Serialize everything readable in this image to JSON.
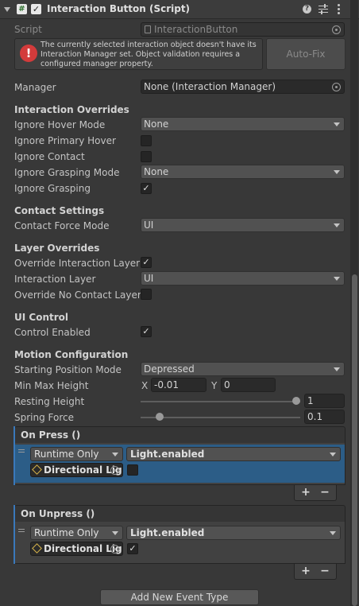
{
  "header": {
    "title": "Interaction Button (Script)",
    "script_icon_glyph": "#"
  },
  "script_row": {
    "label": "Script",
    "value": "InteractionButton"
  },
  "warning": {
    "message": "The currently selected interaction object doesn't have its Interaction Manager set.  Object validation requires a configured manager property.",
    "button": "Auto-Fix",
    "icon_color": "#d33b3b"
  },
  "manager": {
    "label": "Manager",
    "value": "None (Interaction Manager)"
  },
  "interaction_overrides": {
    "title": "Interaction Overrides",
    "ignore_hover_mode": {
      "label": "Ignore Hover Mode",
      "value": "None"
    },
    "ignore_primary_hover": {
      "label": "Ignore Primary Hover",
      "checked": false
    },
    "ignore_contact": {
      "label": "Ignore Contact",
      "checked": false
    },
    "ignore_grasping_mode": {
      "label": "Ignore Grasping Mode",
      "value": "None"
    },
    "ignore_grasping": {
      "label": "Ignore Grasping",
      "checked": true
    }
  },
  "contact_settings": {
    "title": "Contact Settings",
    "contact_force_mode": {
      "label": "Contact Force Mode",
      "value": "UI"
    }
  },
  "layer_overrides": {
    "title": "Layer Overrides",
    "override_interaction_layer": {
      "label": "Override Interaction Layer",
      "checked": true
    },
    "interaction_layer": {
      "label": "Interaction Layer",
      "value": "UI"
    },
    "override_no_contact_layer": {
      "label": "Override No Contact Layer",
      "checked": false
    }
  },
  "ui_control": {
    "title": "UI Control",
    "control_enabled": {
      "label": "Control Enabled",
      "checked": true
    }
  },
  "motion": {
    "title": "Motion Configuration",
    "starting_position_mode": {
      "label": "Starting Position Mode",
      "value": "Depressed"
    },
    "min_max_height": {
      "label": "Min Max Height",
      "x_label": "X",
      "x_value": "-0.01",
      "y_label": "Y",
      "y_value": "0"
    },
    "resting_height": {
      "label": "Resting Height",
      "value": "1",
      "fraction": 1.0
    },
    "spring_force": {
      "label": "Spring Force",
      "value": "0.1",
      "fraction": 0.1
    }
  },
  "on_press": {
    "title": "On Press ()",
    "runtime": "Runtime Only",
    "function": "Light.enabled",
    "object": "Directional Lig",
    "checked": false
  },
  "on_unpress": {
    "title": "On Unpress ()",
    "runtime": "Runtime Only",
    "function": "Light.enabled",
    "object": "Directional Lig",
    "checked": true
  },
  "list_controls": {
    "plus": "+",
    "minus": "−"
  },
  "add_event_button": "Add New Event Type",
  "checkmark": "✓"
}
